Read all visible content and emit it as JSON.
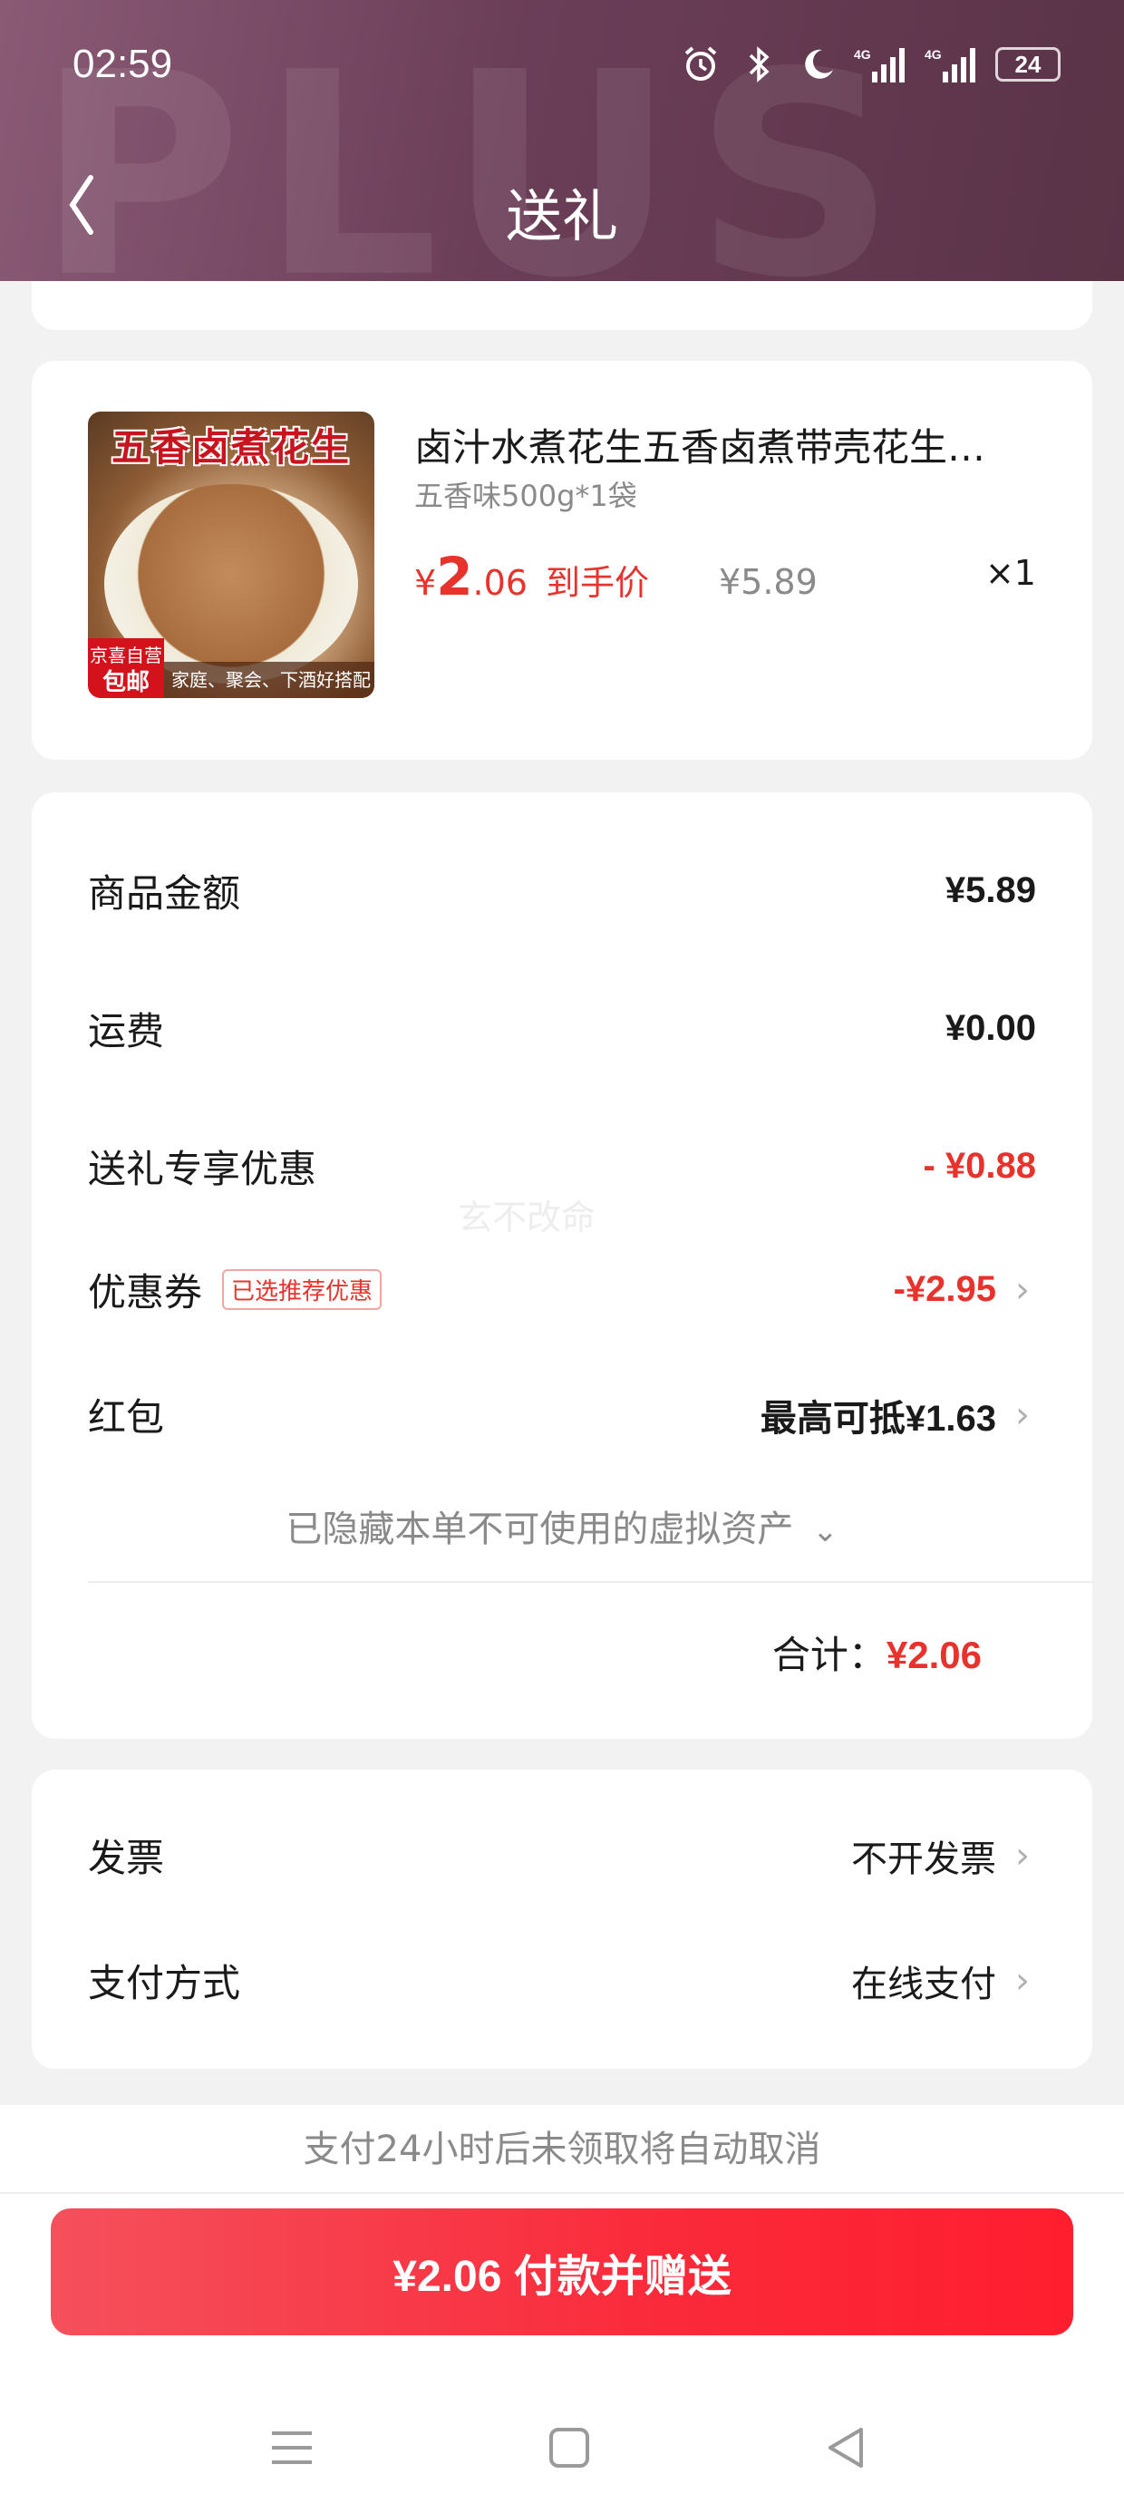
{
  "status_bar": {
    "time": "02:59",
    "battery": "24",
    "icons": [
      "alarm-icon",
      "bluetooth-icon",
      "moon-icon",
      "signal-4g-icon",
      "signal-4g-icon",
      "battery-icon"
    ]
  },
  "header": {
    "watermark": "PLUS",
    "title": "送礼",
    "back_icon": "chevron-left-icon"
  },
  "product": {
    "image_title": "五香卤煮花生",
    "image_badge_line1": "京喜自营",
    "image_badge_line2": "包邮",
    "image_tagline": "家庭、聚会、下酒好搭配",
    "name": "卤汁水煮花生五香卤煮带壳花生…",
    "spec": "五香味500g*1袋",
    "price_currency": "¥",
    "price_int": "2",
    "price_dec": ".06",
    "price_label": "到手价",
    "original_price": "¥5.89",
    "quantity": "×1"
  },
  "summary": {
    "goods_amount_label": "商品金额",
    "goods_amount": "¥5.89",
    "shipping_label": "运费",
    "shipping": "¥0.00",
    "gift_discount_label": "送礼专享优惠",
    "gift_discount": "- ¥0.88",
    "coupon_label": "优惠券",
    "coupon_tag": "已选推荐优惠",
    "coupon_value": "-¥2.95",
    "redpacket_label": "红包",
    "redpacket_value": "最高可抵¥1.63",
    "hidden_assets": "已隐藏本单不可使用的虚拟资产",
    "total_label": "合计：",
    "total_value": "¥2.06",
    "watermark": "玄不改命"
  },
  "payment": {
    "invoice_label": "发票",
    "invoice_value": "不开发票",
    "method_label": "支付方式",
    "method_value": "在线支付"
  },
  "notice": "支付24小时后未领取将自动取消",
  "pay_button": "¥2.06 付款并赠送",
  "colors": {
    "accent_red": "#e8322c",
    "header_purple": "#6b3e58",
    "button_red": "#fa2a3a"
  }
}
